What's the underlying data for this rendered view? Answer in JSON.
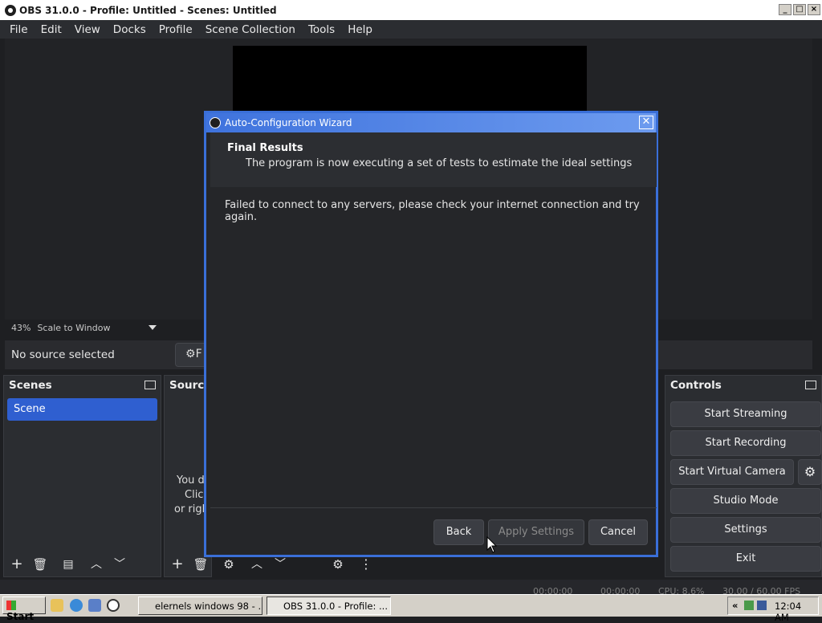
{
  "window": {
    "title": "OBS 31.0.0 - Profile: Untitled - Scenes: Untitled"
  },
  "menu": [
    "File",
    "Edit",
    "View",
    "Docks",
    "Profile",
    "Scene Collection",
    "Tools",
    "Help"
  ],
  "preview": {
    "zoom": "43%",
    "scale_mode": "Scale to Window",
    "source_status": "No source selected",
    "filters_label": "F"
  },
  "scenes": {
    "title": "Scenes",
    "items": [
      "Scene"
    ]
  },
  "sources": {
    "title": "Source",
    "empty_lines": [
      "You d",
      "Click",
      "or righ"
    ]
  },
  "controls": {
    "title": "Controls",
    "buttons": [
      "Start Streaming",
      "Start Recording",
      "Start Virtual Camera",
      "Studio Mode",
      "Settings",
      "Exit"
    ]
  },
  "status": {
    "cpu": "CPU: 8.6%",
    "fps": "30.00 / 60.00 FPS",
    "time1": "00:00:00",
    "time2": "00:00:00"
  },
  "dialog": {
    "title": "Auto-Configuration Wizard",
    "heading": "Final Results",
    "subheading": "The program is now executing a set of tests to estimate the ideal settings",
    "message": "Failed to connect to any servers, please check your internet connection and try again.",
    "buttons": {
      "back": "Back",
      "apply": "Apply Settings",
      "cancel": "Cancel"
    }
  },
  "taskbar": {
    "start": "Start",
    "tasks": [
      "elernels windows 98 - ...",
      "OBS 31.0.0 - Profile: ..."
    ],
    "tray_chevron": "«",
    "clock": "12:04 AM"
  },
  "colors": {
    "accent": "#2f5fd0",
    "dialog_border": "#3a6fd8",
    "bg": "#1e1f22"
  }
}
